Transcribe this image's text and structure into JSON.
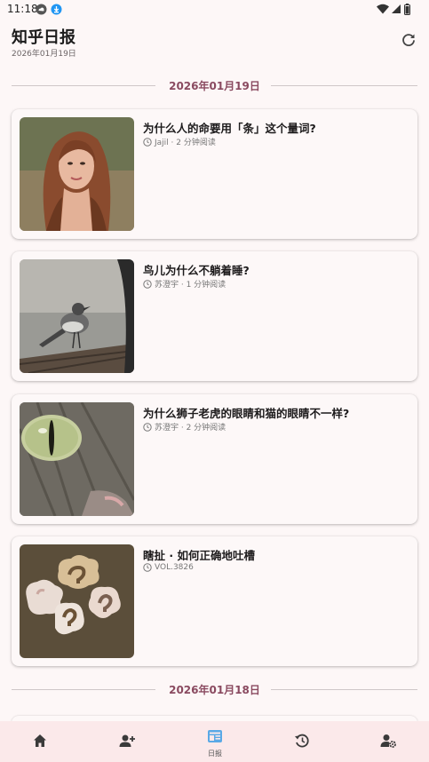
{
  "status": {
    "time": "11:18"
  },
  "header": {
    "title": "知乎日报",
    "subtitle": "2026年01月19日"
  },
  "sections": [
    {
      "date": "2026年01月19日"
    },
    {
      "date": "2026年01月18日"
    }
  ],
  "stories": [
    {
      "title": "为什么人的命要用「条」这个量词?",
      "meta": "Jajil · 2 分钟阅读"
    },
    {
      "title": "鸟儿为什么不躺着睡?",
      "meta": "苏澄宇 · 1 分钟阅读"
    },
    {
      "title": "为什么狮子老虎的眼睛和猫的眼睛不一样?",
      "meta": "苏澄宇 · 2 分钟阅读"
    },
    {
      "title": "瞎扯 · 如何正确地吐槽",
      "meta": "VOL.3826"
    }
  ],
  "nav": {
    "items": [
      {
        "icon": "home-icon"
      },
      {
        "icon": "add-user-icon"
      },
      {
        "icon": "daily-icon",
        "label": "日报",
        "active": true
      },
      {
        "icon": "history-icon"
      },
      {
        "icon": "user-settings-icon"
      }
    ]
  },
  "colors": {
    "accent": "#8a4a60",
    "nav_bg": "#fbe9ea",
    "active_icon": "#5aa9e6"
  }
}
